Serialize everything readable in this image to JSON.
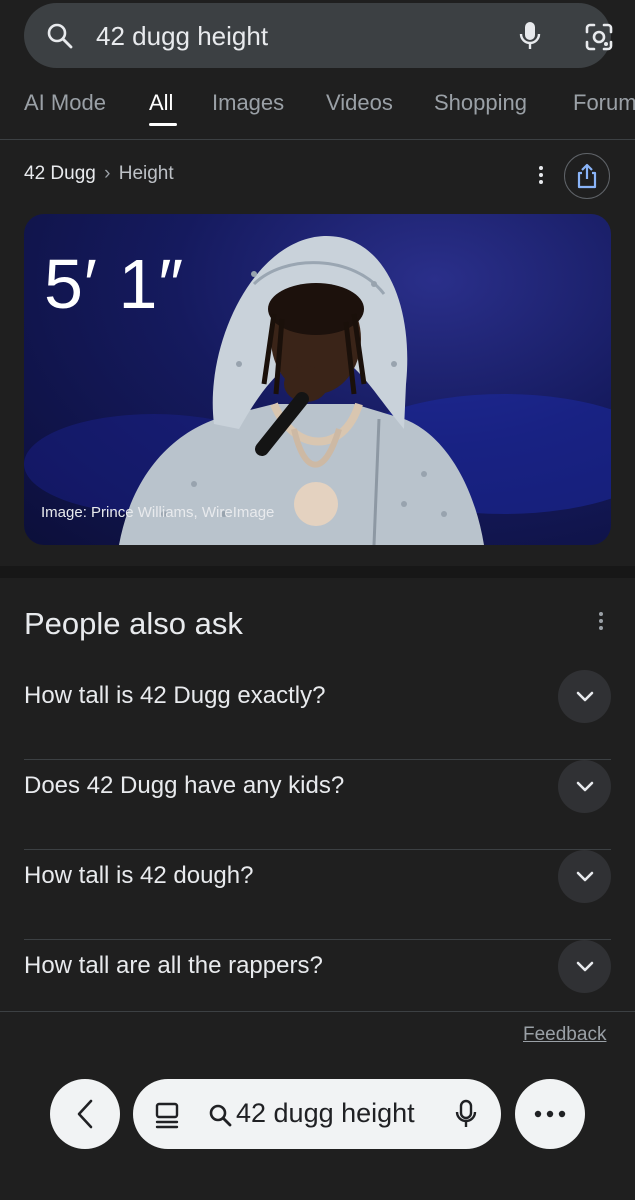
{
  "search": {
    "query": "42 dugg height"
  },
  "tabs": [
    "AI Mode",
    "All",
    "Images",
    "Videos",
    "Shopping",
    "Forum"
  ],
  "active_tab": "All",
  "breadcrumb": {
    "entity": "42 Dugg",
    "separator": "›",
    "attribute": "Height"
  },
  "answer": {
    "height": "5′ 1″",
    "image_credit": "Image: Prince Williams, WireImage"
  },
  "people_also_ask": {
    "title": "People also ask",
    "questions": [
      "How tall is 42 Dugg exactly?",
      "Does 42 Dugg have any kids?",
      "How tall is 42 dough?",
      "How tall are all the rappers?"
    ]
  },
  "feedback_label": "Feedback",
  "bottom_bar": {
    "query": "42 dugg height"
  },
  "icons": {
    "search": "search-icon",
    "mic": "mic-icon",
    "lens": "lens-icon",
    "more": "more-vert-icon",
    "share": "share-icon",
    "expand": "chevron-down-icon",
    "back": "chevron-left-icon",
    "tabs": "tabs-icon",
    "overflow": "more-horiz-icon"
  },
  "colors": {
    "background": "#1f1f1f",
    "surface": "#3c4043",
    "bottom_bar": "#f1f3f4"
  }
}
